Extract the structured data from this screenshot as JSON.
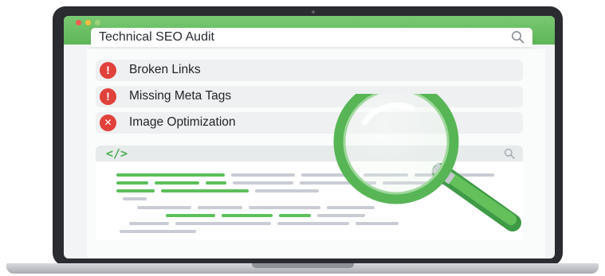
{
  "window": {
    "title": "Technical SEO Audit"
  },
  "issues": [
    {
      "label": "Broken Links",
      "icon": "exclamation-icon",
      "symbol": "!",
      "color": "#e1413b"
    },
    {
      "label": "Missing Meta Tags",
      "icon": "exclamation-icon",
      "symbol": "!",
      "color": "#e1413b"
    },
    {
      "label": "Image Optimization",
      "icon": "x-icon",
      "symbol": "✕",
      "color": "#e1413b"
    }
  ],
  "code": {
    "tag": "</>"
  },
  "colors": {
    "accent": "#5cbf5a",
    "error": "#e1413b",
    "code_line": "#c9ccd4"
  }
}
